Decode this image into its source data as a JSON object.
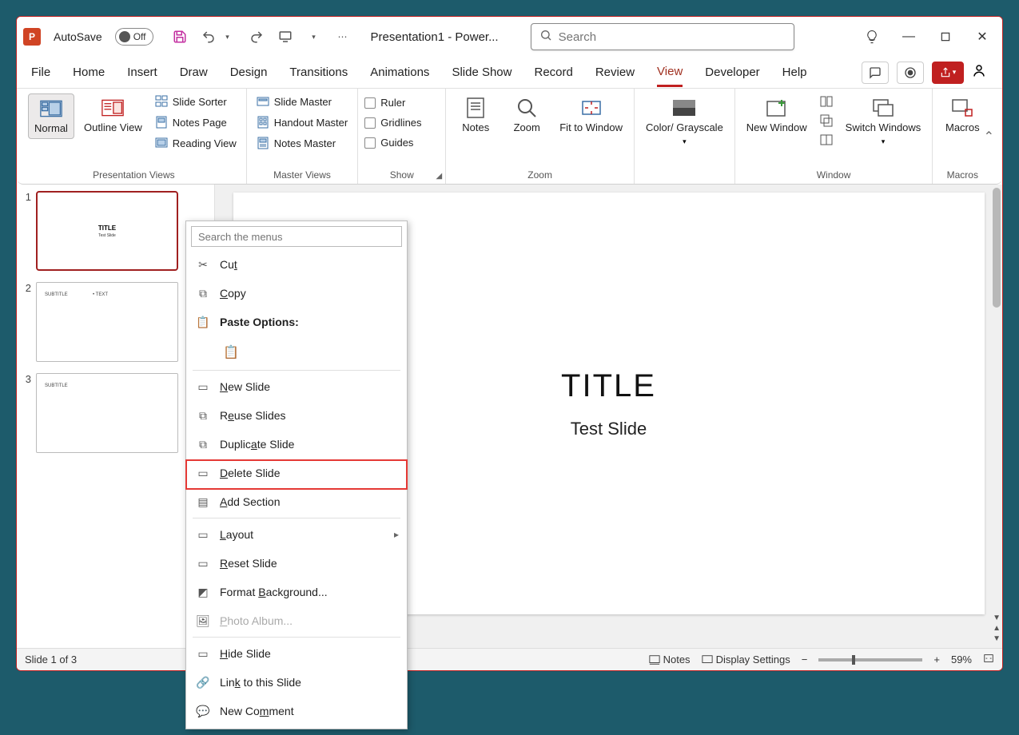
{
  "titlebar": {
    "autosave_label": "AutoSave",
    "autosave_state": "Off",
    "doc_title": "Presentation1 - Power...",
    "search_placeholder": "Search"
  },
  "tabs": [
    "File",
    "Home",
    "Insert",
    "Draw",
    "Design",
    "Transitions",
    "Animations",
    "Slide Show",
    "Record",
    "Review",
    "View",
    "Developer",
    "Help"
  ],
  "active_tab": "View",
  "ribbon": {
    "presentation_views": {
      "normal": "Normal",
      "outline": "Outline View",
      "slide_sorter": "Slide Sorter",
      "notes_page": "Notes Page",
      "reading_view": "Reading View",
      "caption": "Presentation Views"
    },
    "master_views": {
      "slide_master": "Slide Master",
      "handout_master": "Handout Master",
      "notes_master": "Notes Master",
      "caption": "Master Views"
    },
    "show": {
      "ruler": "Ruler",
      "gridlines": "Gridlines",
      "guides": "Guides",
      "caption": "Show"
    },
    "zoom": {
      "notes": "Notes",
      "zoom": "Zoom",
      "fit": "Fit to Window",
      "caption": "Zoom"
    },
    "color": {
      "label": "Color/ Grayscale"
    },
    "window": {
      "new": "New Window",
      "switch": "Switch Windows",
      "caption": "Window"
    },
    "macros": {
      "label": "Macros",
      "caption": "Macros"
    }
  },
  "thumbnails": [
    {
      "num": "1",
      "title": "TITLE",
      "sub": "Test Slide",
      "selected": true,
      "layout": "title"
    },
    {
      "num": "2",
      "subtitle": "SUBTITLE",
      "text": "• TEXT",
      "selected": false,
      "layout": "content"
    },
    {
      "num": "3",
      "subtitle": "SUBTITLE",
      "selected": false,
      "layout": "content"
    }
  ],
  "slide": {
    "title": "TITLE",
    "subtitle": "Test Slide"
  },
  "status": {
    "slide_indicator": "Slide 1 of 3",
    "notes": "Notes",
    "display_settings": "Display Settings",
    "zoom": "59%"
  },
  "context_menu": {
    "search_placeholder": "Search the menus",
    "cut": "Cut",
    "copy": "Copy",
    "paste_options": "Paste Options:",
    "new_slide": "New Slide",
    "reuse_slides": "Reuse Slides",
    "duplicate_slide": "Duplicate Slide",
    "delete_slide": "Delete Slide",
    "add_section": "Add Section",
    "layout": "Layout",
    "reset_slide": "Reset Slide",
    "format_background": "Format Background...",
    "photo_album": "Photo Album...",
    "hide_slide": "Hide Slide",
    "link_to_slide": "Link to this Slide",
    "new_comment": "New Comment"
  }
}
